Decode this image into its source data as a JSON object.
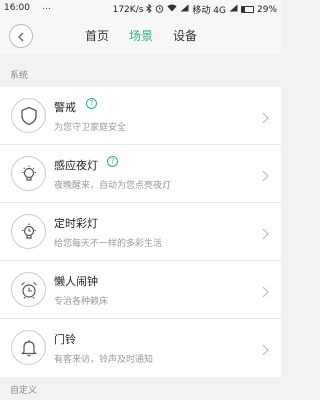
{
  "status": {
    "time": "16:00",
    "dots": "…",
    "speed": "172K/s",
    "carrier": "移动 4G",
    "battery": "29%"
  },
  "header": {
    "tabs": [
      {
        "label": "首页",
        "active": false
      },
      {
        "label": "场景",
        "active": true
      },
      {
        "label": "设备",
        "active": false
      }
    ]
  },
  "sections": {
    "system": "系统",
    "custom": "自定义"
  },
  "scenes": [
    {
      "title": "警戒",
      "desc": "为您守卫家庭安全",
      "help": "?",
      "icon": "shield-icon"
    },
    {
      "title": "感应夜灯",
      "desc": "夜晚醒来，自动为您点亮夜灯",
      "help": "?",
      "icon": "bulb-icon"
    },
    {
      "title": "定时彩灯",
      "desc": "给您每天不一样的多彩生活",
      "icon": "timer-bulb-icon"
    },
    {
      "title": "懒人闹钟",
      "desc": "专治各种赖床",
      "icon": "alarm-clock-icon"
    },
    {
      "title": "门铃",
      "desc": "有客来访，铃声及时通知",
      "icon": "bell-icon"
    }
  ],
  "colors": {
    "accent": "#2db089"
  }
}
